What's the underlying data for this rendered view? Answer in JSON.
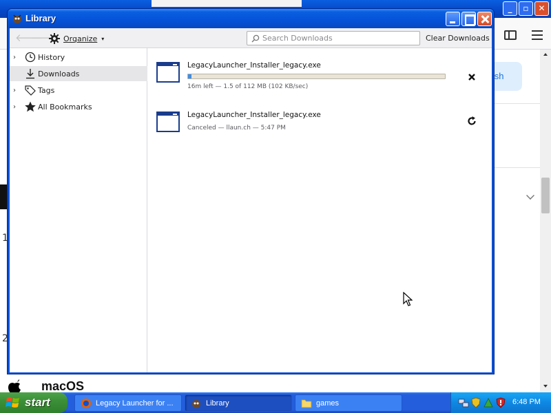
{
  "library_window": {
    "title": "Library",
    "toolbar": {
      "organize_label": "Organize",
      "search_placeholder": "Search Downloads",
      "clear_downloads_label": "Clear Downloads"
    },
    "sidebar": {
      "items": [
        {
          "label": "History",
          "icon": "clock-icon",
          "expandable": true,
          "selected": false
        },
        {
          "label": "Downloads",
          "icon": "download-icon",
          "expandable": false,
          "selected": true
        },
        {
          "label": "Tags",
          "icon": "tag-icon",
          "expandable": true,
          "selected": false
        },
        {
          "label": "All Bookmarks",
          "icon": "star-icon",
          "expandable": true,
          "selected": false
        }
      ]
    },
    "downloads": [
      {
        "filename": "LegacyLauncher_Installer_legacy.exe",
        "status": "16m left — 1.5 of 112 MB (102 KB/sec)",
        "progress": 0.014,
        "action_icon": "cancel-icon"
      },
      {
        "filename": "LegacyLauncher_Installer_legacy.exe",
        "status": "Canceled — llaun.ch — 5:47 PM",
        "action_icon": "retry-icon"
      }
    ]
  },
  "background_page": {
    "button_text": "lish",
    "bottom_heading": "macOS",
    "left_numbers": [
      "1",
      "2"
    ]
  },
  "taskbar": {
    "start_label": "start",
    "tasks": [
      {
        "label": "Legacy Launcher for ...",
        "icon": "firefox-icon",
        "active": false
      },
      {
        "label": "Library",
        "icon": "library-icon",
        "active": true
      },
      {
        "label": "games",
        "icon": "folder-icon",
        "active": false
      }
    ],
    "clock": "6:48 PM"
  },
  "colors": {
    "xp_blue": "#0552d8",
    "selected_row": "#e6e6e8",
    "progress_fill": "#3d8ee8",
    "start_green": "#3c9038"
  }
}
